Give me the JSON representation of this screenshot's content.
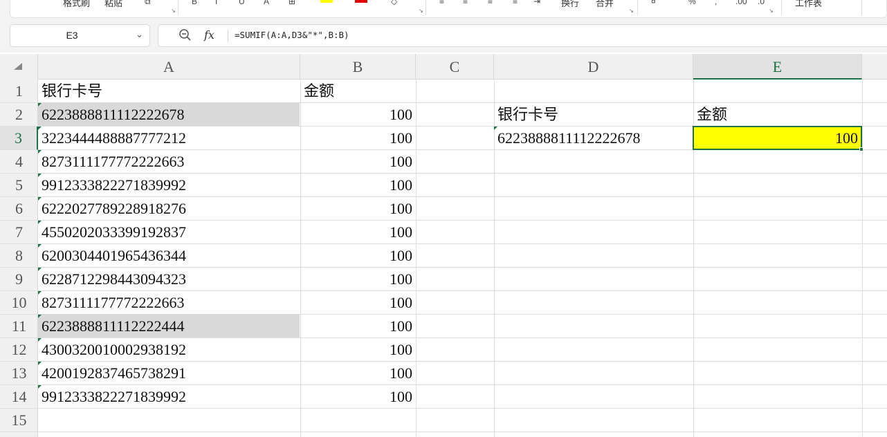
{
  "ribbon": {
    "labels": [
      "格式刷",
      "粘贴"
    ],
    "right_labels": [
      "换行",
      "合并",
      "工作表"
    ]
  },
  "formula_bar": {
    "name_box": "E3",
    "formula": "=SUMIF(A:A,D3&\"*\",B:B)",
    "fx_label": "fx"
  },
  "sheet": {
    "columns": [
      "A",
      "B",
      "C",
      "D",
      "E"
    ],
    "active_column": "E",
    "rows": [
      "1",
      "2",
      "3",
      "4",
      "5",
      "6",
      "7",
      "8",
      "9",
      "10",
      "11",
      "12",
      "13",
      "14",
      "15"
    ],
    "active_row": "3",
    "header_a": "银行卡号",
    "header_b": "金额",
    "cards": [
      "6223888811112222678",
      "3223444488887777212",
      "8273111177772222663",
      "9912333822271839992",
      "6222027789228918276",
      "4550202033399192837",
      "6200304401965436344",
      "6228712298443094323",
      "8273111177772222663",
      "6223888811112222444",
      "4300320010002938192",
      "4200192837465738291",
      "9912333822271839992"
    ],
    "amounts": [
      "100",
      "100",
      "100",
      "100",
      "100",
      "100",
      "100",
      "100",
      "100",
      "100",
      "100",
      "100",
      "100"
    ],
    "lookup_header_d": "银行卡号",
    "lookup_header_e": "金额",
    "lookup_card": "6223888811112222678",
    "lookup_result": "100",
    "highlight_fill": "#d9d9d9",
    "selected_fill": "#ffff00",
    "accent": "#1e7145"
  }
}
